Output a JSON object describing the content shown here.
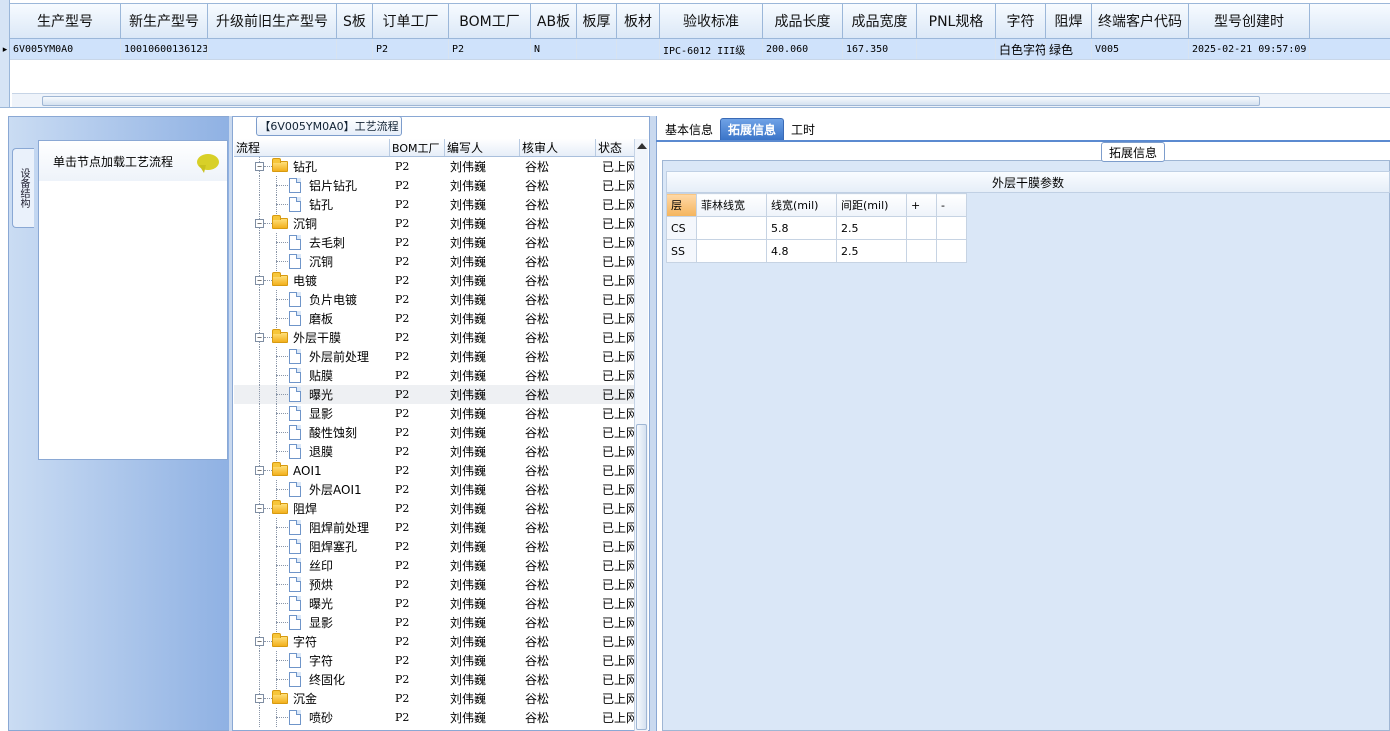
{
  "top_grid": {
    "columns": [
      "生产型号",
      "新生产型号",
      "升级前旧生产型号",
      "S板",
      "订单工厂",
      "BOM工厂",
      "AB板",
      "板厚",
      "板材",
      "验收标准",
      "成品长度",
      "成品宽度",
      "PNL规格",
      "字符",
      "阻焊",
      "终端客户代码",
      "型号创建时"
    ],
    "row": [
      "6V005YM0A0",
      "10010600136123",
      "",
      "",
      "P2",
      "P2",
      "N",
      "",
      "",
      "IPC-6012 III级",
      "200.060",
      "167.350",
      "",
      "白色字符",
      "绿色",
      "V005",
      "2025-02-21 09:57:09"
    ],
    "row_marker": "▸"
  },
  "left_panel": {
    "vertical_tab": "设备结构",
    "title": "单击节点加载工艺流程"
  },
  "flow": {
    "title": "【6V005YM0A0】工艺流程",
    "headers": [
      "流程",
      "BOM工厂",
      "编写人",
      "核审人",
      "状态"
    ],
    "rows": [
      {
        "type": "group",
        "name": "钻孔",
        "bom": "P2",
        "writer": "刘伟巍",
        "checker": "谷松",
        "status": "已上网"
      },
      {
        "type": "item",
        "name": "铝片钻孔",
        "bom": "P2",
        "writer": "刘伟巍",
        "checker": "谷松",
        "status": "已上网"
      },
      {
        "type": "item",
        "name": "钻孔",
        "bom": "P2",
        "writer": "刘伟巍",
        "checker": "谷松",
        "status": "已上网"
      },
      {
        "type": "group",
        "name": "沉铜",
        "bom": "P2",
        "writer": "刘伟巍",
        "checker": "谷松",
        "status": "已上网"
      },
      {
        "type": "item",
        "name": "去毛刺",
        "bom": "P2",
        "writer": "刘伟巍",
        "checker": "谷松",
        "status": "已上网"
      },
      {
        "type": "item",
        "name": "沉铜",
        "bom": "P2",
        "writer": "刘伟巍",
        "checker": "谷松",
        "status": "已上网"
      },
      {
        "type": "group",
        "name": "电镀",
        "bom": "P2",
        "writer": "刘伟巍",
        "checker": "谷松",
        "status": "已上网"
      },
      {
        "type": "item",
        "name": "负片电镀",
        "bom": "P2",
        "writer": "刘伟巍",
        "checker": "谷松",
        "status": "已上网"
      },
      {
        "type": "item",
        "name": "磨板",
        "bom": "P2",
        "writer": "刘伟巍",
        "checker": "谷松",
        "status": "已上网"
      },
      {
        "type": "group",
        "name": "外层干膜",
        "bom": "P2",
        "writer": "刘伟巍",
        "checker": "谷松",
        "status": "已上网"
      },
      {
        "type": "item",
        "name": "外层前处理",
        "bom": "P2",
        "writer": "刘伟巍",
        "checker": "谷松",
        "status": "已上网"
      },
      {
        "type": "item",
        "name": "贴膜",
        "bom": "P2",
        "writer": "刘伟巍",
        "checker": "谷松",
        "status": "已上网"
      },
      {
        "type": "item",
        "name": "曝光",
        "bom": "P2",
        "writer": "刘伟巍",
        "checker": "谷松",
        "status": "已上网",
        "selected": true
      },
      {
        "type": "item",
        "name": "显影",
        "bom": "P2",
        "writer": "刘伟巍",
        "checker": "谷松",
        "status": "已上网"
      },
      {
        "type": "item",
        "name": "酸性蚀刻",
        "bom": "P2",
        "writer": "刘伟巍",
        "checker": "谷松",
        "status": "已上网"
      },
      {
        "type": "item",
        "name": "退膜",
        "bom": "P2",
        "writer": "刘伟巍",
        "checker": "谷松",
        "status": "已上网"
      },
      {
        "type": "group",
        "name": "AOI1",
        "bom": "P2",
        "writer": "刘伟巍",
        "checker": "谷松",
        "status": "已上网"
      },
      {
        "type": "item",
        "name": "外层AOI1",
        "bom": "P2",
        "writer": "刘伟巍",
        "checker": "谷松",
        "status": "已上网"
      },
      {
        "type": "group",
        "name": "阻焊",
        "bom": "P2",
        "writer": "刘伟巍",
        "checker": "谷松",
        "status": "已上网"
      },
      {
        "type": "item",
        "name": "阻焊前处理",
        "bom": "P2",
        "writer": "刘伟巍",
        "checker": "谷松",
        "status": "已上网"
      },
      {
        "type": "item",
        "name": "阻焊塞孔",
        "bom": "P2",
        "writer": "刘伟巍",
        "checker": "谷松",
        "status": "已上网"
      },
      {
        "type": "item",
        "name": "丝印",
        "bom": "P2",
        "writer": "刘伟巍",
        "checker": "谷松",
        "status": "已上网"
      },
      {
        "type": "item",
        "name": "预烘",
        "bom": "P2",
        "writer": "刘伟巍",
        "checker": "谷松",
        "status": "已上网"
      },
      {
        "type": "item",
        "name": "曝光",
        "bom": "P2",
        "writer": "刘伟巍",
        "checker": "谷松",
        "status": "已上网"
      },
      {
        "type": "item",
        "name": "显影",
        "bom": "P2",
        "writer": "刘伟巍",
        "checker": "谷松",
        "status": "已上网"
      },
      {
        "type": "group",
        "name": "字符",
        "bom": "P2",
        "writer": "刘伟巍",
        "checker": "谷松",
        "status": "已上网"
      },
      {
        "type": "item",
        "name": "字符",
        "bom": "P2",
        "writer": "刘伟巍",
        "checker": "谷松",
        "status": "已上网"
      },
      {
        "type": "item",
        "name": "终固化",
        "bom": "P2",
        "writer": "刘伟巍",
        "checker": "谷松",
        "status": "已上网"
      },
      {
        "type": "group",
        "name": "沉金",
        "bom": "P2",
        "writer": "刘伟巍",
        "checker": "谷松",
        "status": "已上网"
      },
      {
        "type": "item",
        "name": "喷砂",
        "bom": "P2",
        "writer": "刘伟巍",
        "checker": "谷松",
        "status": "已上网"
      }
    ]
  },
  "right_panel": {
    "tabs": [
      {
        "label": "基本信息",
        "active": false
      },
      {
        "label": "拓展信息",
        "active": true
      },
      {
        "label": "工时",
        "active": false
      }
    ],
    "legend": "拓展信息",
    "table_title": "外层干膜参数",
    "table_headers": [
      "层",
      "菲林线宽",
      "线宽(mil)",
      "间距(mil)",
      "+",
      "-"
    ],
    "table_rows": [
      [
        "CS",
        "",
        "5.8",
        "2.5",
        "",
        ""
      ],
      [
        "SS",
        "",
        "4.8",
        "2.5",
        "",
        ""
      ]
    ]
  },
  "colors": {
    "accent": "#3a74c8",
    "header_bg": "#dbe8f7",
    "selected_row": "#cfe2fb",
    "frame_bg": "#dae7f7"
  }
}
